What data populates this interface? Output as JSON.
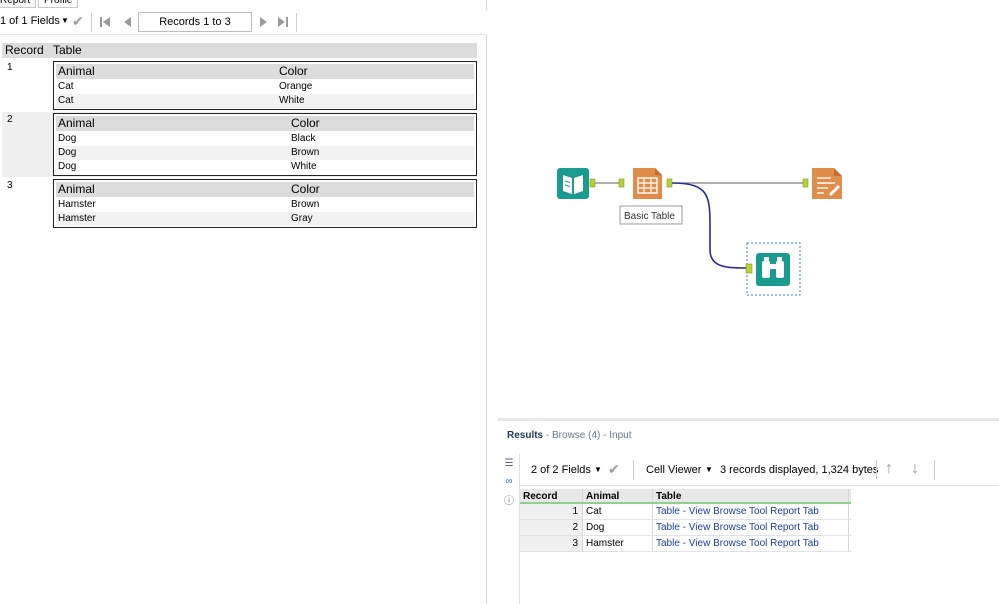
{
  "report": {
    "tabs": [
      "Report",
      "Profile"
    ],
    "fields_label": "1 of 1 Fields",
    "records_label": "Records 1 to 3",
    "columns": [
      "Record",
      "Table"
    ],
    "records": [
      {
        "num": "1",
        "headers": [
          "Animal",
          "Color"
        ],
        "rows": [
          [
            "Cat",
            "Orange"
          ],
          [
            "Cat",
            "White"
          ]
        ]
      },
      {
        "num": "2",
        "headers": [
          "Animal",
          "Color"
        ],
        "rows": [
          [
            "Dog",
            "Black"
          ],
          [
            "Dog",
            "Brown"
          ],
          [
            "Dog",
            "White"
          ]
        ]
      },
      {
        "num": "3",
        "headers": [
          "Animal",
          "Color"
        ],
        "rows": [
          [
            "Hamster",
            "Brown"
          ],
          [
            "Hamster",
            "Gray"
          ]
        ]
      }
    ]
  },
  "canvas": {
    "tool_label": "Basic Table",
    "colors": {
      "input": "#1a9b8f",
      "table": "#e08c4a",
      "render": "#e08c4a",
      "browse": "#1a9b8f",
      "connector_blue": "#2a2aa0",
      "connector_gray": "#808080",
      "anchor": "#b5d334"
    }
  },
  "results": {
    "title": "Results",
    "subtitle": "- Browse (4) - Input",
    "fields_label": "2 of 2 Fields",
    "viewer_label": "Cell Viewer",
    "status": "3 records displayed, 1,324 bytes",
    "columns": [
      "Record",
      "Animal",
      "Table"
    ],
    "rows": [
      {
        "record": "1",
        "animal": "Cat",
        "table": "Table - View Browse Tool Report Tab"
      },
      {
        "record": "2",
        "animal": "Dog",
        "table": "Table - View Browse Tool Report Tab"
      },
      {
        "record": "3",
        "animal": "Hamster",
        "table": "Table - View Browse Tool Report Tab"
      }
    ]
  }
}
